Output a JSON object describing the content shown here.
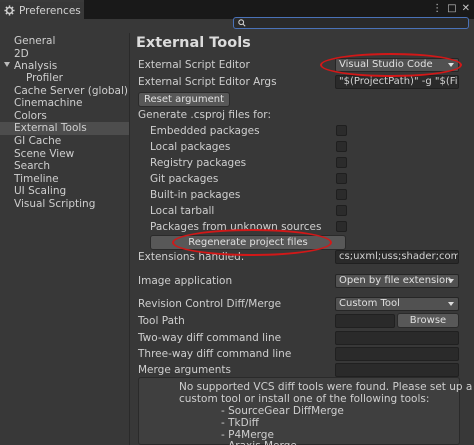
{
  "window": {
    "title": "Preferences",
    "controls": [
      "⋮",
      "□",
      "✕"
    ]
  },
  "search": {
    "value": ""
  },
  "sidebar": {
    "items": [
      {
        "label": "General"
      },
      {
        "label": "2D"
      },
      {
        "label": "Analysis"
      },
      {
        "label": "Profiler"
      },
      {
        "label": "Cache Server (global)"
      },
      {
        "label": "Cinemachine"
      },
      {
        "label": "Colors"
      },
      {
        "label": "External Tools"
      },
      {
        "label": "GI Cache"
      },
      {
        "label": "Scene View"
      },
      {
        "label": "Search"
      },
      {
        "label": "Timeline"
      },
      {
        "label": "UI Scaling"
      },
      {
        "label": "Visual Scripting"
      }
    ],
    "selected": "External Tools"
  },
  "main": {
    "heading": "External Tools",
    "script_editor_label": "External Script Editor",
    "script_editor_value": "Visual Studio Code",
    "script_args_label": "External Script Editor Args",
    "script_args_value": "\"$(ProjectPath)\" -g \"$(File",
    "reset_button": "Reset argument",
    "csproj_label": "Generate .csproj files for:",
    "csproj_options": [
      {
        "label": "Embedded packages",
        "checked": false
      },
      {
        "label": "Local packages",
        "checked": false
      },
      {
        "label": "Registry packages",
        "checked": false
      },
      {
        "label": "Git packages",
        "checked": false
      },
      {
        "label": "Built-in packages",
        "checked": false
      },
      {
        "label": "Local tarball",
        "checked": false
      },
      {
        "label": "Packages from unknown sources",
        "checked": false
      }
    ],
    "regen_button": "Regenerate project files",
    "extensions_label": "Extensions handled:",
    "extensions_value": "cs;uxml;uss;shader;compu",
    "image_app_label": "Image application",
    "image_app_value": "Open by file extension",
    "rev_control_label": "Revision Control Diff/Merge",
    "rev_control_value": "Custom Tool",
    "tool_path_label": "Tool Path",
    "tool_path_value": "",
    "browse_button": "Browse",
    "two_way_label": "Two-way diff command line",
    "two_way_value": "",
    "three_way_label": "Three-way diff command line",
    "three_way_value": "",
    "merge_args_label": "Merge arguments",
    "merge_args_value": "",
    "help_lines": [
      "No supported VCS diff tools were found. Please set up a",
      "custom tool or install one of the following tools:",
      "- SourceGear DiffMerge",
      "- TkDiff",
      "- P4Merge",
      "- Araxis Merge"
    ]
  },
  "colors": {
    "panel": "#383838",
    "selection": "#4d4d4d",
    "highlight_ring": "#d21818",
    "search_focus": "#4a72b8"
  }
}
